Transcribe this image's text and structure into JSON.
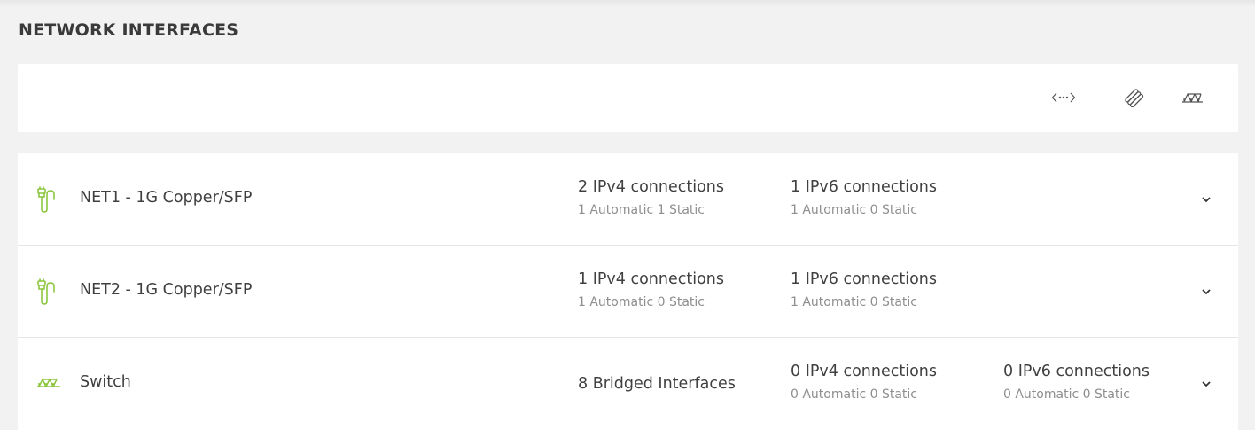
{
  "section": {
    "title": "NETWORK INTERFACES"
  },
  "toolbar": {
    "buttons": [
      {
        "icon": "vlan-icon"
      },
      {
        "icon": "bond-icon"
      },
      {
        "icon": "bridge-icon"
      }
    ]
  },
  "colors": {
    "accent": "#8cc63f",
    "text": "#3f3f3f",
    "muted": "#8e8e8e",
    "background": "#f2f2f2",
    "card": "#ffffff"
  },
  "interfaces": [
    {
      "icon": "ethernet-icon",
      "name": "NET1 - 1G Copper/SFP",
      "ipv4": {
        "main": "2 IPv4 connections",
        "sub": "1 Automatic 1 Static"
      },
      "ipv6": {
        "main": "1 IPv6 connections",
        "sub": "1 Automatic 0 Static"
      }
    },
    {
      "icon": "ethernet-icon",
      "name": "NET2 - 1G Copper/SFP",
      "ipv4": {
        "main": "1 IPv4 connections",
        "sub": "1 Automatic 0 Static"
      },
      "ipv6": {
        "main": "1 IPv6 connections",
        "sub": "1 Automatic 0 Static"
      }
    },
    {
      "icon": "bridge-icon",
      "name": "Switch",
      "bridged": {
        "main": "8 Bridged Interfaces"
      },
      "ipv4": {
        "main": "0 IPv4 connections",
        "sub": "0 Automatic 0 Static"
      },
      "ipv6": {
        "main": "0 IPv6 connections",
        "sub": "0 Automatic 0 Static"
      }
    }
  ]
}
